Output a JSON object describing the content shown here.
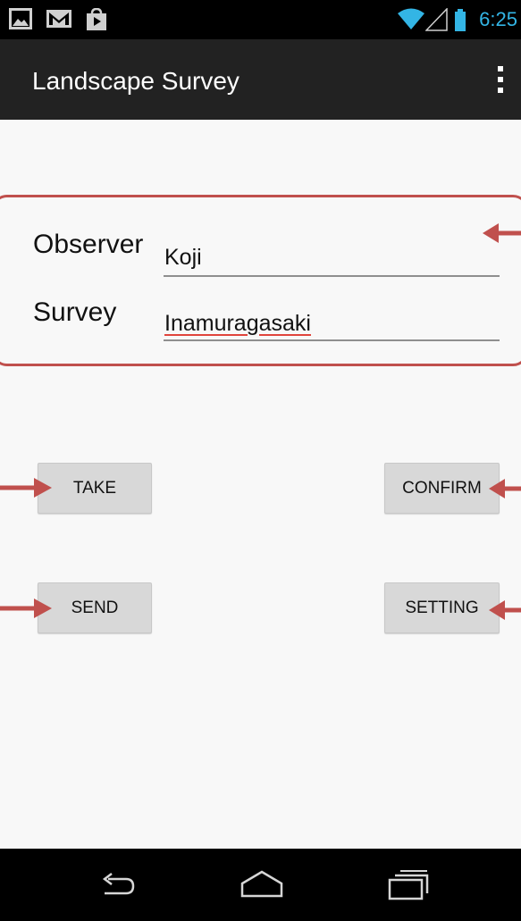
{
  "status_bar": {
    "time": "6:25",
    "left_icons": [
      "gallery-icon",
      "gmail-icon",
      "shopping-bag-icon"
    ],
    "right_icons": [
      "wifi-icon",
      "signal-icon",
      "battery-icon"
    ],
    "accent_color": "#33b5e5"
  },
  "action_bar": {
    "title": "Landscape Survey",
    "menu_icon": "overflow-menu-icon"
  },
  "form": {
    "observer": {
      "label": "Observer",
      "value": "Koji"
    },
    "survey": {
      "label": "Survey",
      "value": "Inamuragasaki"
    }
  },
  "buttons": {
    "take": "TAKE",
    "confirm": "CONFIRM",
    "send": "SEND",
    "setting": "SETTING"
  },
  "annotation": {
    "color": "#c0504d"
  },
  "nav_bar": {
    "icons": [
      "back-icon",
      "home-icon",
      "recents-icon"
    ]
  }
}
